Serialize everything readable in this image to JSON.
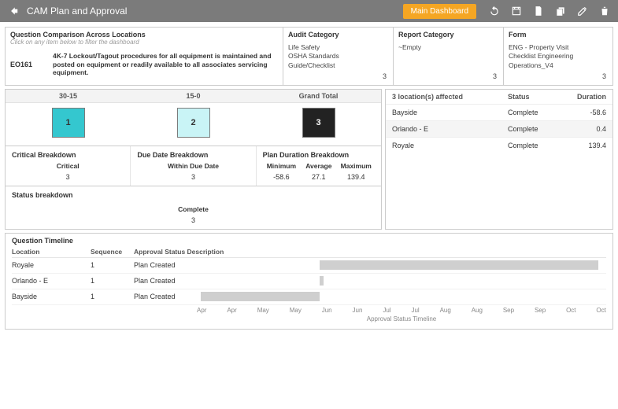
{
  "header": {
    "title": "CAM Plan and Approval",
    "main_dashboard_label": "Main Dashboard"
  },
  "qc": {
    "title": "Question Comparison Across Locations",
    "subtitle": "Click on any item below to filter the dashboard",
    "code": "EO161",
    "text": "4K-7 Lockout/Tagout procedures for all equipment is maintained and posted on equipment or readily available to all associates servicing equipment."
  },
  "audit_category": {
    "title": "Audit Category",
    "value": "Life Safety\nOSHA Standards\nGuide/Checklist",
    "count": "3"
  },
  "report_category": {
    "title": "Report Category",
    "value": "~Empty",
    "count": "3"
  },
  "form": {
    "title": "Form",
    "value": "ENG - Property Visit\nChecklist Engineering\nOperations_V4",
    "count": "3"
  },
  "tiles": {
    "headers": [
      "30-15",
      "15-0",
      "Grand Total"
    ],
    "values": [
      "1",
      "2",
      "3"
    ]
  },
  "critical_bd": {
    "title": "Critical Breakdown",
    "label": "Critical",
    "value": "3"
  },
  "due_bd": {
    "title": "Due Date Breakdown",
    "label": "Within Due Date",
    "value": "3"
  },
  "plan_bd": {
    "title": "Plan Duration Breakdown",
    "cols": {
      "min_label": "Minimum",
      "min_val": "-58.6",
      "avg_label": "Average",
      "avg_val": "27.1",
      "max_label": "Maximum",
      "max_val": "139.4"
    }
  },
  "status_bd": {
    "title": "Status breakdown",
    "label": "Complete",
    "value": "3"
  },
  "locations": {
    "head_affected": "3  location(s) affected",
    "head_status": "Status",
    "head_duration": "Duration",
    "rows": [
      {
        "name": "Bayside",
        "status": "Complete",
        "duration": "-58.6"
      },
      {
        "name": "Orlando - E",
        "status": "Complete",
        "duration": "0.4"
      },
      {
        "name": "Royale",
        "status": "Complete",
        "duration": "139.4"
      }
    ]
  },
  "timeline": {
    "title": "Question Timeline",
    "head_location": "Location",
    "head_sequence": "Sequence",
    "head_approval": "Approval Status Description",
    "axis_label": "Approval Status Timeline",
    "rows": [
      {
        "location": "Royale",
        "sequence": "1",
        "approval": "Plan Created"
      },
      {
        "location": "Orlando - E",
        "sequence": "1",
        "approval": "Plan Created"
      },
      {
        "location": "Bayside",
        "sequence": "1",
        "approval": "Plan Created"
      }
    ],
    "axis_ticks": [
      "Apr",
      "Apr",
      "May",
      "May",
      "Jun",
      "Jun",
      "Jul",
      "Jul",
      "Aug",
      "Aug",
      "Sep",
      "Sep",
      "Oct",
      "Oct"
    ]
  },
  "chart_data": {
    "type": "bar",
    "orientation": "horizontal",
    "title": "Approval Status Timeline",
    "x_axis": {
      "type": "time",
      "ticks": [
        "Apr",
        "Apr",
        "May",
        "May",
        "Jun",
        "Jun",
        "Jul",
        "Jul",
        "Aug",
        "Aug",
        "Sep",
        "Sep",
        "Oct",
        "Oct"
      ]
    },
    "series": [
      {
        "name": "Royale",
        "start": "Jun 1",
        "end": "Oct 20"
      },
      {
        "name": "Orlando - E",
        "start": "Jun 1",
        "end": "Jun 2"
      },
      {
        "name": "Bayside",
        "start": "Apr 5",
        "end": "Jun 1"
      }
    ]
  }
}
